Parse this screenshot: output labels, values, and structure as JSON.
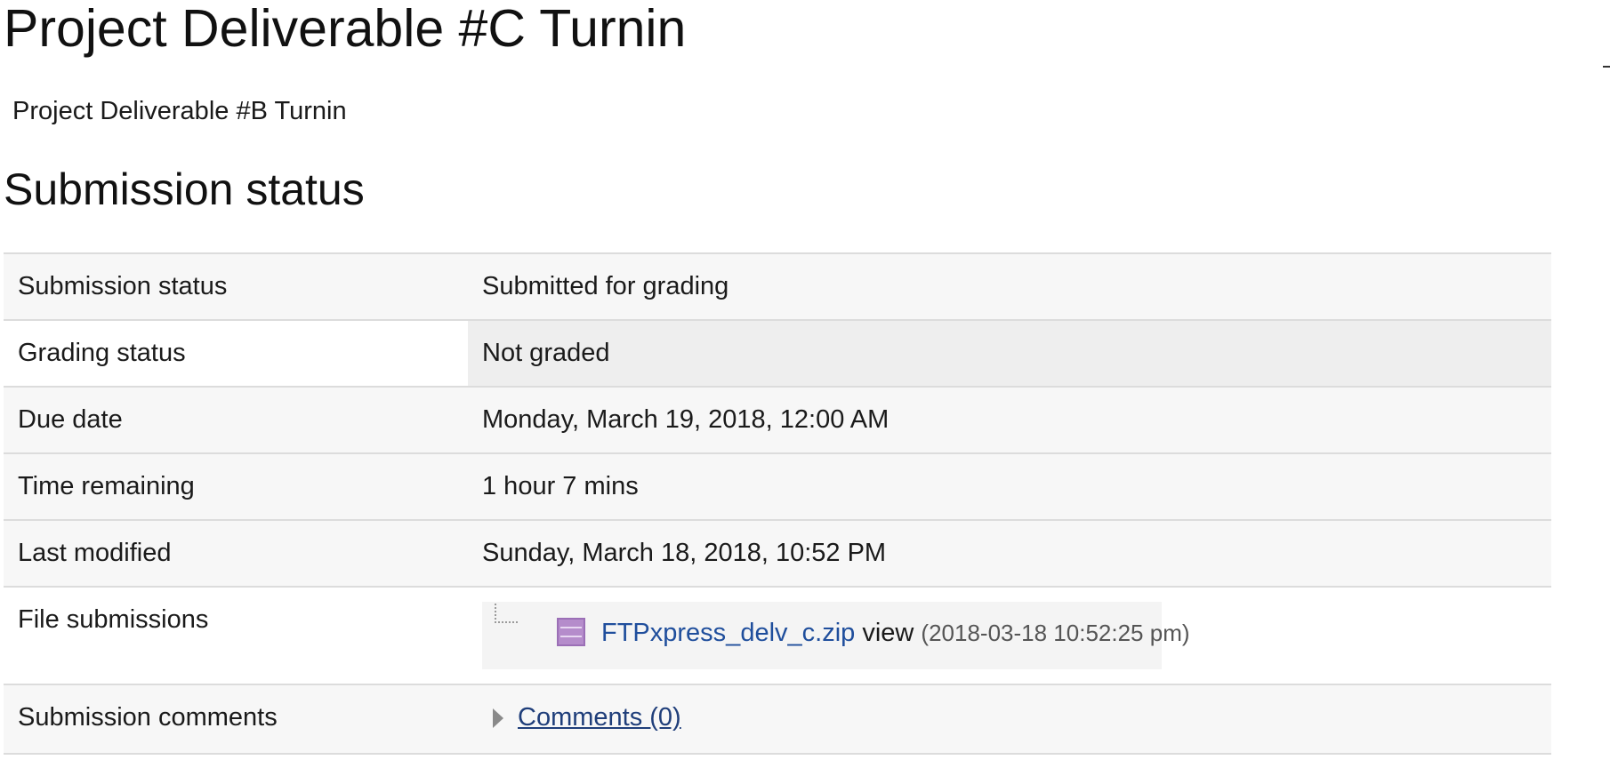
{
  "page": {
    "title": "Project Deliverable #C Turnin",
    "previous_link": "Project Deliverable #B Turnin",
    "section_title": "Submission status"
  },
  "status_table": {
    "rows": [
      {
        "label": "Submission status",
        "value": "Submitted for grading"
      },
      {
        "label": "Grading status",
        "value": "Not graded"
      },
      {
        "label": "Due date",
        "value": "Monday, March 19, 2018, 12:00 AM"
      },
      {
        "label": "Time remaining",
        "value": "1 hour 7 mins"
      },
      {
        "label": "Last modified",
        "value": "Sunday, March 18, 2018, 10:52 PM"
      }
    ],
    "files": {
      "label": "File submissions",
      "file_name": "FTPxpress_delv_c.zip",
      "view_label": "view",
      "timestamp": "(2018-03-18 10:52:25 pm)",
      "icon": "archive-icon"
    },
    "comments": {
      "label": "Submission comments",
      "link": "Comments (0)",
      "icon": "triangle-right-icon"
    }
  },
  "colors": {
    "link_blue": "#1f4e9c",
    "row_background": "#f7f7f7",
    "highlight_cell": "#eeeeee",
    "border": "#dcdcdc",
    "archive_icon": "#b58ccb"
  }
}
